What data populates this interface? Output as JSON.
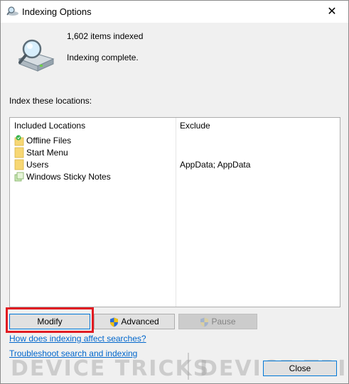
{
  "window": {
    "title": "Indexing Options",
    "close_glyph": "✕"
  },
  "summary": {
    "items_indexed": "1,602 items indexed",
    "status": "Indexing complete."
  },
  "locations": {
    "label": "Index these locations:",
    "columns": {
      "included": "Included Locations",
      "exclude": "Exclude"
    },
    "rows": [
      {
        "name": "Offline Files",
        "exclude": "",
        "icon": "offline-files-icon"
      },
      {
        "name": "Start Menu",
        "exclude": "",
        "icon": "folder-icon"
      },
      {
        "name": "Users",
        "exclude": "AppData; AppData",
        "icon": "folder-icon"
      },
      {
        "name": "Windows Sticky Notes",
        "exclude": "",
        "icon": "sticky-notes-icon"
      }
    ]
  },
  "buttons": {
    "modify": "Modify",
    "advanced": "Advanced",
    "pause": "Pause",
    "close": "Close"
  },
  "links": {
    "how_affects": "How does indexing affect searches?",
    "troubleshoot": "Troubleshoot search and indexing"
  },
  "watermark": {
    "left": "DEVICE TRICKS",
    "right": "DEVICE TRICK"
  },
  "colors": {
    "link": "#0066cc",
    "highlight": "#e11b22",
    "focus": "#0078d7"
  }
}
